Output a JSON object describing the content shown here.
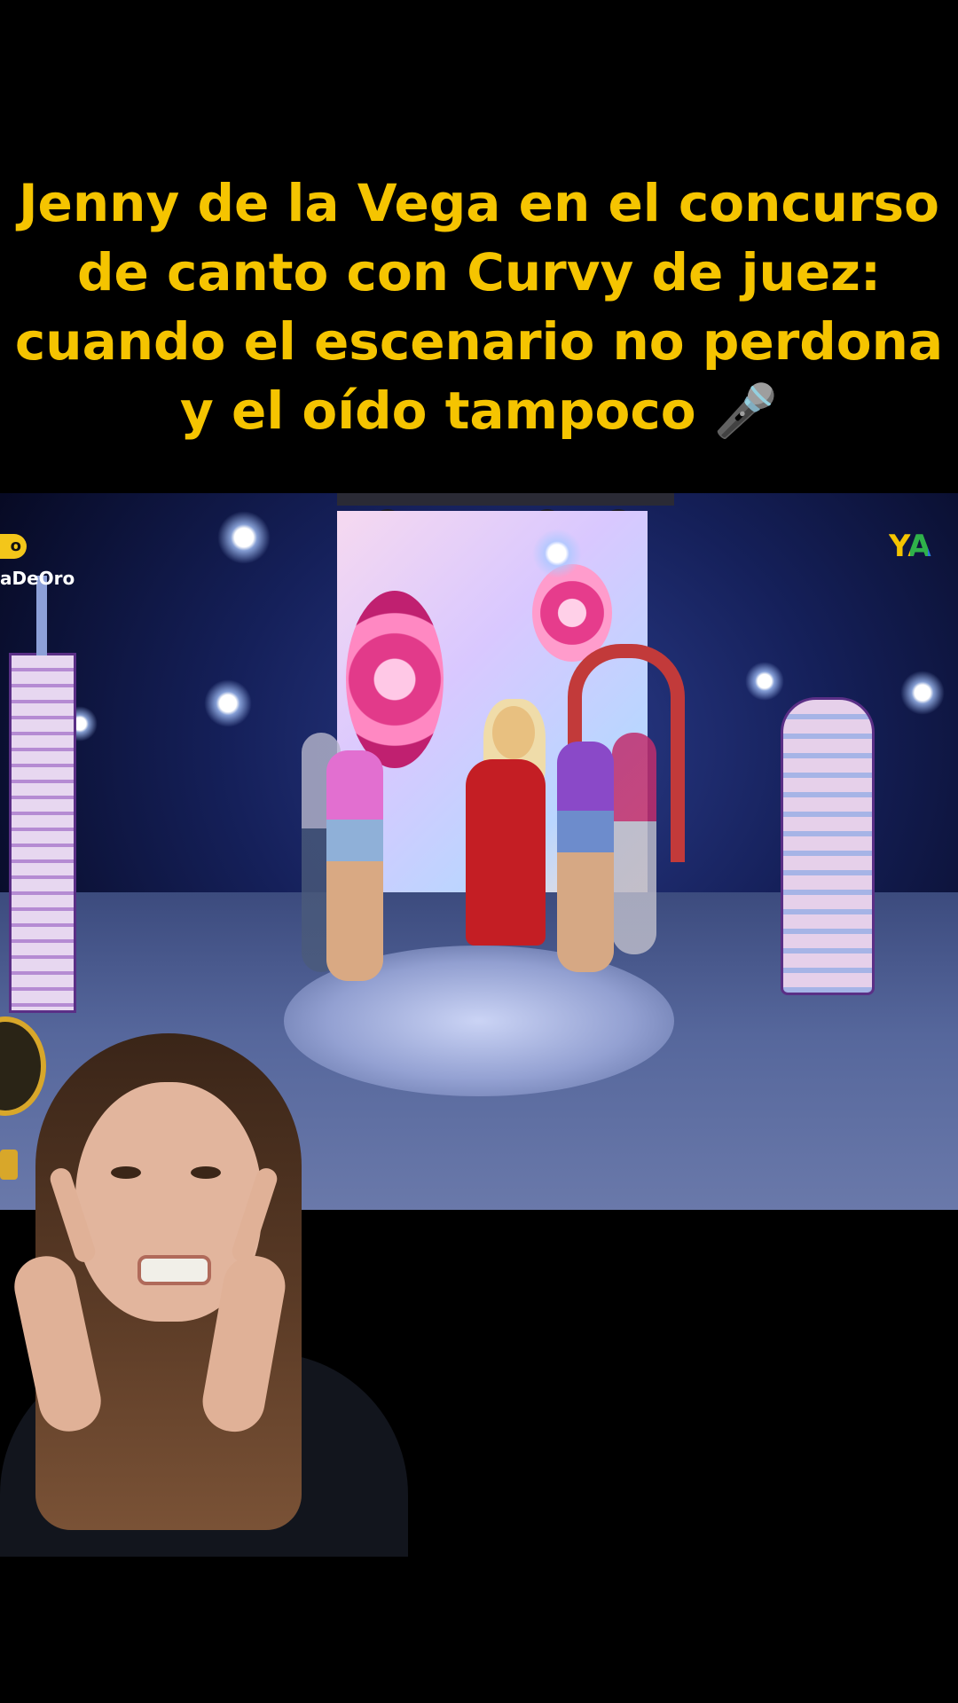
{
  "caption": {
    "lines": [
      "Jenny de la Vega en el concurso",
      "de canto con Curvy de juez:",
      "cuando el escenario no perdona",
      "y el oído tampoco 🎤"
    ]
  },
  "video": {
    "watermark_pill": "o",
    "hashtag_fragment": "aDeOro",
    "logo_text": "YA",
    "logo_colors": [
      "#f4c400",
      "#2fb24a",
      "#2a7ad8",
      "#e23a3a"
    ]
  },
  "overlay_person": {
    "description_icon": "person-reaction"
  },
  "colors": {
    "caption_text": "#f5c400",
    "background": "#000000"
  }
}
